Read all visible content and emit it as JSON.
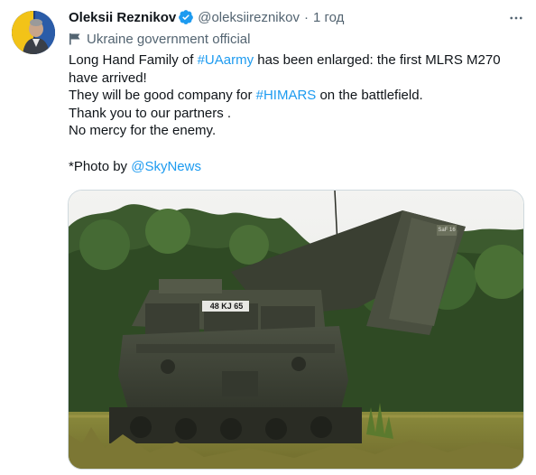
{
  "author": {
    "name": "Oleksii Reznikov",
    "handle": "@oleksiireznikov",
    "separator": "·",
    "time": "1 год",
    "label": "Ukraine government official"
  },
  "tweet": {
    "line1_a": "Long Hand Family of ",
    "line1_tag": "#UAarmy",
    "line1_b": " has been enlarged: the first MLRS M270 have arrived!",
    "line2_a": "They will be good company for ",
    "line2_tag": "#HIMARS",
    "line2_b": " on the battlefield.",
    "line3": "Thank you to our partners .",
    "line4": "No mercy for the enemy.",
    "line5_a": "*Photo by ",
    "line5_mention": "@SkyNews"
  },
  "media": {
    "plate": "48 KJ 65",
    "launcher_marking": "SaF 16"
  },
  "icons": {
    "verified": "verified-badge-icon",
    "more": "more-options-icon",
    "label": "government-flag-icon"
  },
  "colors": {
    "link": "#1d9bf0",
    "secondary": "#536471",
    "text": "#0f1419"
  }
}
